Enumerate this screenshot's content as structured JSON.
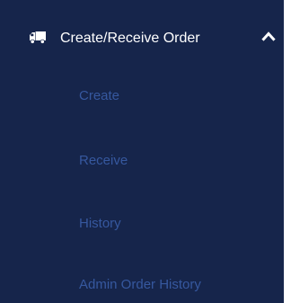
{
  "sidebar": {
    "section": {
      "label": "Create/Receive Order",
      "icon": "truck-icon",
      "expanded": true,
      "chevron_icon": "chevron-up-icon"
    },
    "items": [
      {
        "label": "Create"
      },
      {
        "label": "Receive"
      },
      {
        "label": "History"
      },
      {
        "label": "Admin Order History"
      }
    ]
  },
  "colors": {
    "sidebar_bg": "#16254b",
    "header_text": "#ffffff",
    "submenu_text": "#36589f",
    "page_bg": "#ffffff"
  }
}
